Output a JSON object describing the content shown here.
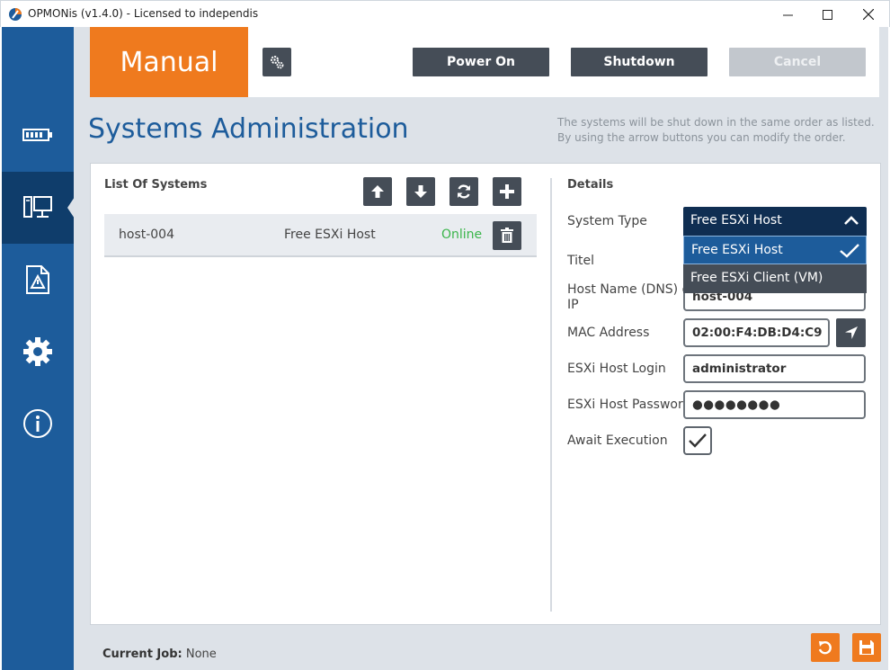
{
  "window": {
    "title": "OPMONis (v1.4.0) - Licensed to independis"
  },
  "header": {
    "mode": "Manual",
    "power_on_label": "Power On",
    "shutdown_label": "Shutdown",
    "cancel_label": "Cancel"
  },
  "page": {
    "title": "Systems Administration",
    "hint": "The systems will be shut down in the same order as listed. By using the arrow buttons you can modify the order."
  },
  "list": {
    "title": "List Of Systems",
    "rows": [
      {
        "name": "host-004",
        "type": "Free ESXi Host",
        "status": "Online"
      }
    ],
    "status_color": "#3ab54a"
  },
  "details": {
    "title": "Details",
    "system_type_label": "System Type",
    "system_type_value": "Free ESXi Host",
    "system_type_options": [
      "Free ESXi Host",
      "Free ESXi Client (VM)"
    ],
    "titel_label": "Titel",
    "hostname_label_line1": "Host Name (DNS) or",
    "hostname_label_line2": "IP",
    "hostname_value": "host-004",
    "mac_label": "MAC Address",
    "mac_value": "02:00:F4:DB:D4:C9",
    "login_label": "ESXi Host Login",
    "login_value": "administrator",
    "password_label": "ESXi Host Password",
    "password_value": "●●●●●●●●",
    "await_label": "Await Execution",
    "await_checked": true
  },
  "footer": {
    "current_job_label": "Current Job:",
    "current_job_value": "None"
  },
  "colors": {
    "accent": "#ef7a1e",
    "sidebar": "#1d5c9b",
    "sidebar_active": "#0f3d6b",
    "button": "#454d57"
  },
  "icons": [
    "battery-icon",
    "systems-icon",
    "warning-document-icon",
    "settings-gear-icon",
    "info-icon"
  ]
}
